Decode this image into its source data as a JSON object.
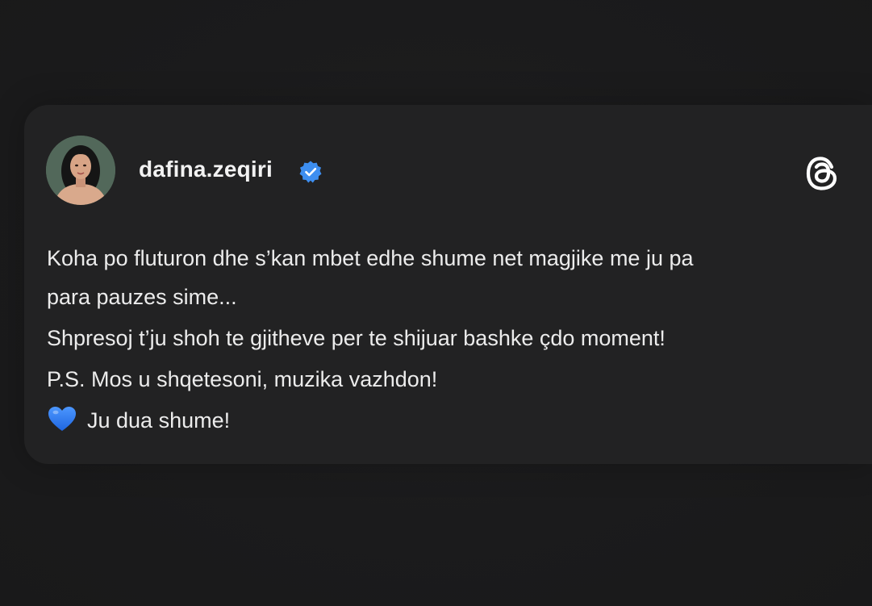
{
  "post": {
    "username": "dafina.zeqiri",
    "verified": true,
    "lines": [
      "Koha po fluturon dhe s’kan mbet edhe shume net magjike me ju pa",
      "para pauzes sime...",
      "Shpresoj t’ju shoh te gjitheve per te shijuar bashke çdo moment!",
      "P.S. Mos u shqetesoni, muzika vazhdon!",
      "Ju dua shume!"
    ],
    "closing_emoji": "blue-heart-icon"
  },
  "icons": {
    "avatar": "profile-photo",
    "badge": "verified-badge-icon",
    "brand": "threads-logo-icon"
  },
  "colors": {
    "background": "#1b1b1c",
    "card": "#222223",
    "verified_blue": "#3d8ef0",
    "heart_blue": "#2d7cf6",
    "text": "#ececec"
  }
}
